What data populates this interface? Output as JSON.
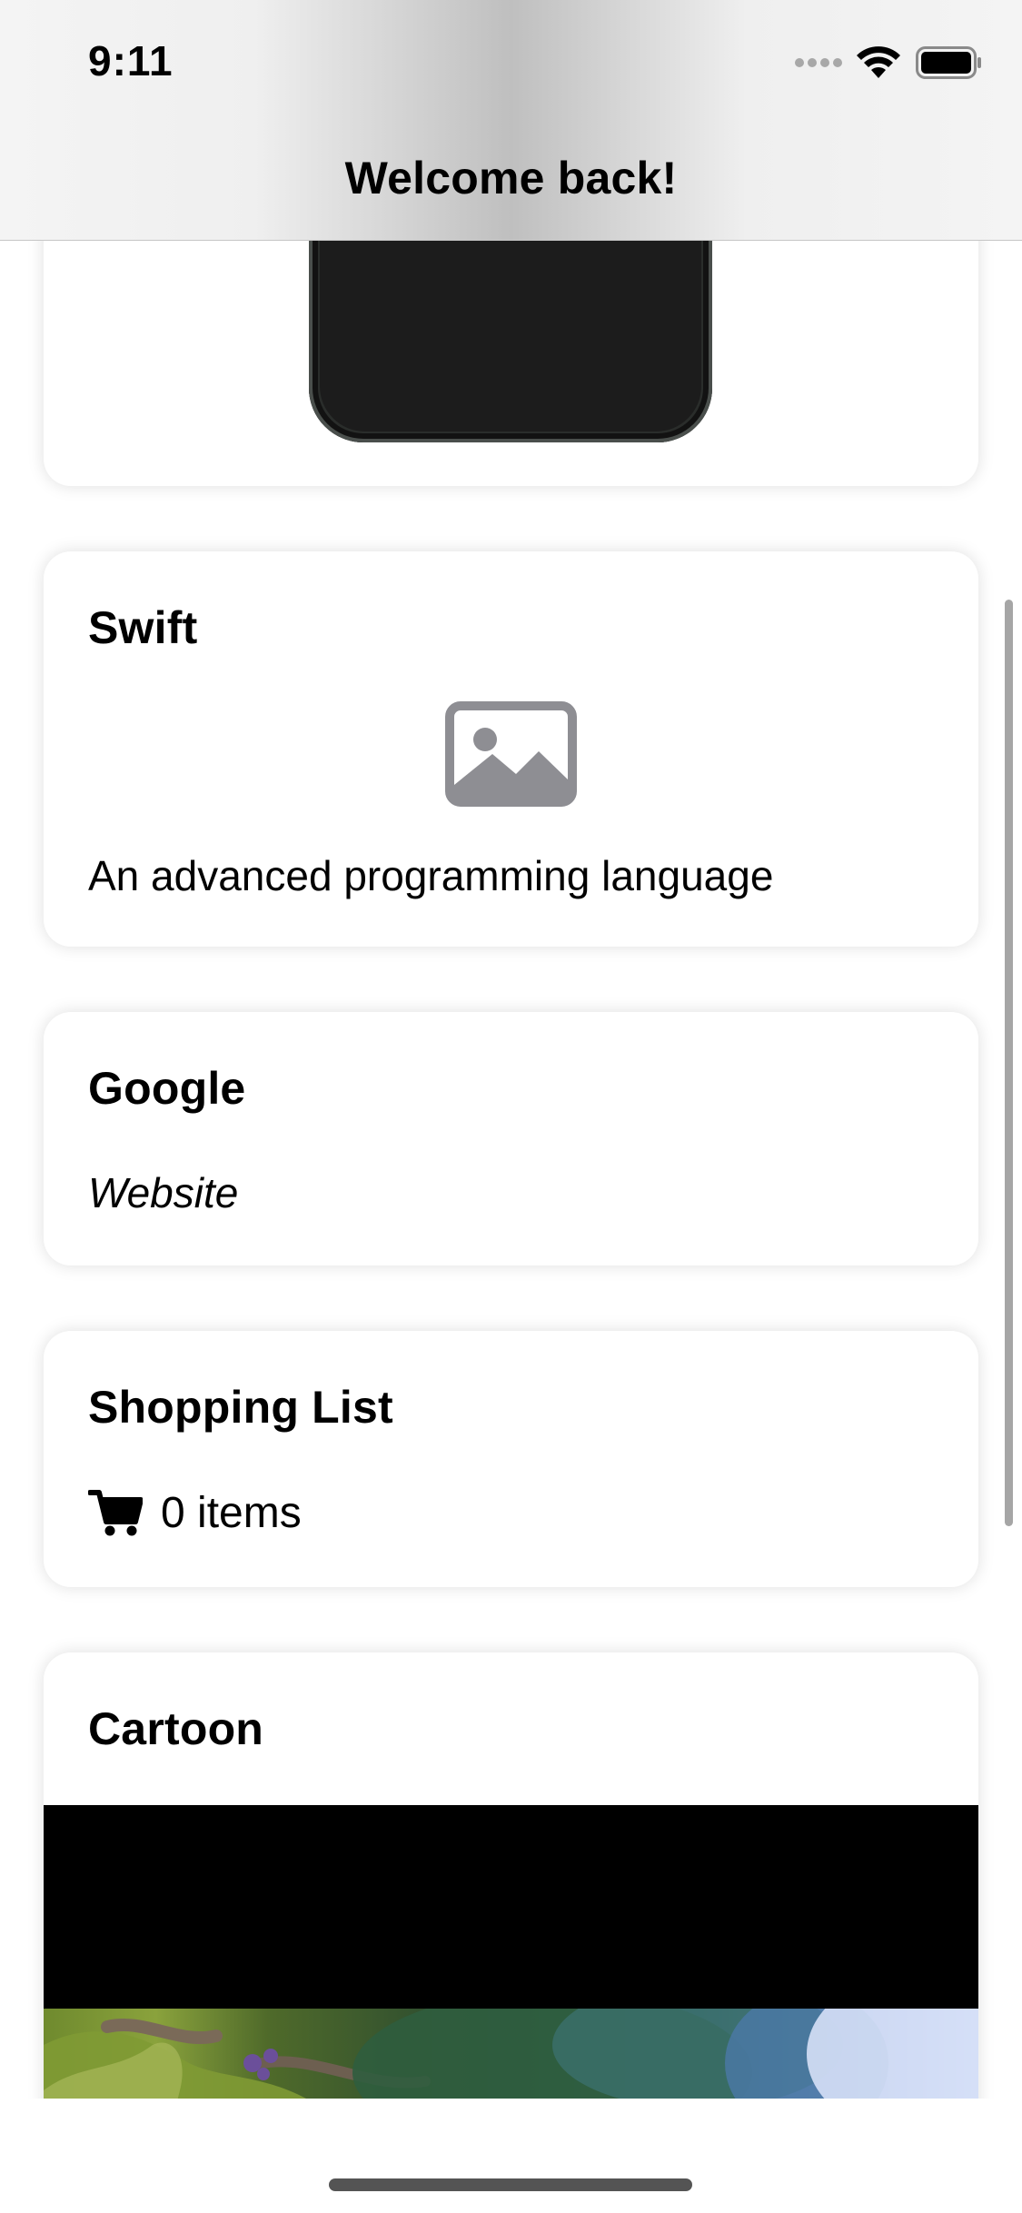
{
  "status_bar": {
    "time": "9:11",
    "icons": [
      "signal-icon",
      "wifi-icon",
      "battery-icon"
    ]
  },
  "nav": {
    "title": "Welcome back!"
  },
  "cards": {
    "phone": {
      "image": "phone-image"
    },
    "swift": {
      "title": "Swift",
      "image": "image-placeholder-icon",
      "description": "An advanced programming language"
    },
    "google": {
      "title": "Google",
      "subtitle": "Website"
    },
    "shopping": {
      "title": "Shopping List",
      "icon": "cart-icon",
      "count": "0 items"
    },
    "cartoon": {
      "title": "Cartoon",
      "media": "video-player"
    }
  },
  "colors": {
    "card_background": "#ffffff",
    "placeholder_gray": "#8e8e93",
    "text": "#000000",
    "home_indicator": "#1b1b1b"
  }
}
